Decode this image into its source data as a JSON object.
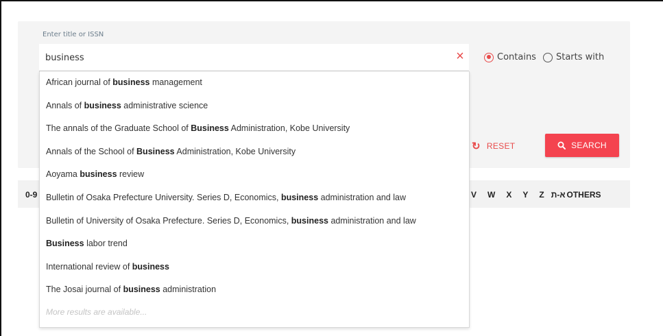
{
  "search": {
    "label": "Enter title or ISSN",
    "value": "business",
    "clear_icon": "×",
    "options": [
      {
        "label": "Contains",
        "checked": true
      },
      {
        "label": "Starts with",
        "checked": false
      }
    ],
    "reset_label": "RESET",
    "search_label": "SEARCH"
  },
  "colors": {
    "accent": "#f4434f",
    "accent_text": "#e84a4a",
    "panel_bg": "#f4f4f4"
  },
  "alphabet": {
    "visible_left": "0-9",
    "visible_right": [
      "V",
      "W",
      "X",
      "Y",
      "Z",
      "א-ת",
      "OTHERS"
    ]
  },
  "suggestions": [
    {
      "pre": "African journal of ",
      "match": "business",
      "post": " management"
    },
    {
      "pre": "Annals of ",
      "match": "business",
      "post": " administrative science"
    },
    {
      "pre": "The annals of the Graduate School of ",
      "match": "Business",
      "post": " Administration, Kobe University"
    },
    {
      "pre": "Annals of the School of ",
      "match": "Business",
      "post": " Administration, Kobe University"
    },
    {
      "pre": "Aoyama ",
      "match": "business",
      "post": " review"
    },
    {
      "pre": "Bulletin of Osaka Prefecture University. Series D, Economics, ",
      "match": "business",
      "post": " administration and law"
    },
    {
      "pre": "Bulletin of University of Osaka Prefecture. Series D, Economics, ",
      "match": "business",
      "post": " administration and law"
    },
    {
      "pre": "",
      "match": "Business",
      "post": " labor trend"
    },
    {
      "pre": "International review of ",
      "match": "business",
      "post": ""
    },
    {
      "pre": "The Josai journal of ",
      "match": "business",
      "post": " administration"
    }
  ],
  "more_results": "More results are available..."
}
